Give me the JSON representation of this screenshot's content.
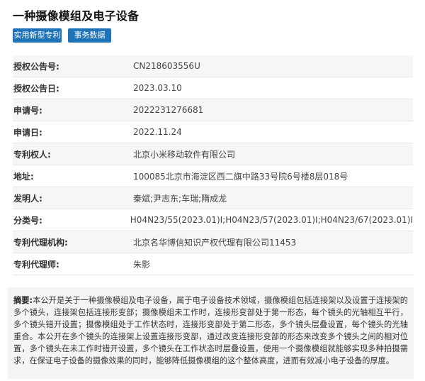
{
  "title": "一种摄像模组及电子设备",
  "tags": [
    {
      "label": "实用新型专利"
    },
    {
      "label": "事务数据"
    }
  ],
  "fields": [
    {
      "label": "授权公告号:",
      "value": "CN218603556U"
    },
    {
      "label": "授权公告日:",
      "value": "2023.03.10"
    },
    {
      "label": "申请号:",
      "value": "2022231276681"
    },
    {
      "label": "申请日:",
      "value": "2022.11.24"
    },
    {
      "label": "专利权人:",
      "value": "北京小米移动软件有限公司"
    },
    {
      "label": "地址:",
      "value": "100085北京市海淀区西二旗中路33号院6号楼8层018号"
    },
    {
      "label": "发明人:",
      "value": "秦斌;尹志东;车瑞;隋成龙"
    },
    {
      "label": "分类号:",
      "value": "H04N23/55(2023.01)I;H04N23/57(2023.01)I;H04N23/67(2023.01)I"
    },
    {
      "label": "专利代理机构:",
      "value": "北京名华博信知识产权代理有限公司11453"
    },
    {
      "label": "专利代理师:",
      "value": "朱影"
    }
  ],
  "abstract": {
    "label": "摘要:",
    "text": "本公开是关于一种摄像模组及电子设备，属于电子设备技术领域，摄像模组包括连接架以及设置于连接架的多个镜头，连接架包括连接形变部；摄像模组未工作时，连接形变部处于第一形态，每个镜头的光轴相互平行，多个镜头错开设置；摄像模组处于工作状态时，连接形变部处于第二形态，多个镜头层叠设置，每个镜头的光轴重合。本公开在多个镜头的连接架上设置连接形变部，通过改变连接形变部的形态来改变多个镜头之间的相对位置，多个镜头在未工作时错开设置，多个镜头在工作状态时层叠设置，使用一个摄像模组就能够实现多种拍摄需求，在保证电子设备的摄像效果的同时，能够降低摄像模组的这个整体高度，进而有效减小电子设备的厚度。"
  }
}
